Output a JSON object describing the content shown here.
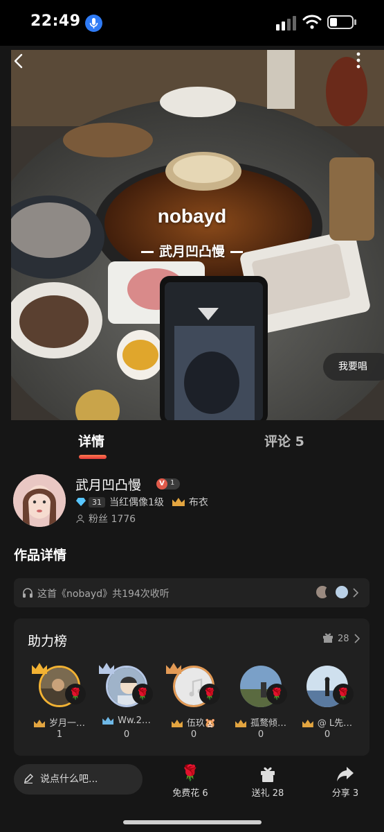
{
  "status_bar": {
    "time": "22:49"
  },
  "song": {
    "title": "nobayd",
    "artist": "武月凹凸慢",
    "sing_button": "我要唱"
  },
  "tabs": [
    {
      "label": "详情"
    },
    {
      "label": "评论 5"
    }
  ],
  "user": {
    "name": "武月凹凸慢",
    "vip_letter": "V",
    "vip_level": "1",
    "diamond_count": "31",
    "idol_level": "当红偶像1级",
    "title": "布衣",
    "fans": "粉丝 1776"
  },
  "section_title": "作品详情",
  "listen_info": "这首《nobayd》共194次收听",
  "board": {
    "title": "助力榜",
    "gift_count": "28",
    "ranks": [
      {
        "rank": "1",
        "name": "岁月一…",
        "score": "1",
        "crown_color": "#f2b233"
      },
      {
        "rank": "2",
        "name": "Ww.2…",
        "score": "0",
        "crown_color": "#b6c8e6"
      },
      {
        "rank": "3",
        "name": "伍玖🐹",
        "score": "0",
        "crown_color": "#e39a55"
      },
      {
        "rank": "",
        "name": "孤鹜倾…",
        "score": "0",
        "crown_color": ""
      },
      {
        "rank": "",
        "name": "@ L先…",
        "score": "0",
        "crown_color": ""
      }
    ]
  },
  "bottom": {
    "comment_placeholder": "说点什么吧...",
    "free_flowers": "免费花 6",
    "send_gift": "送礼 28",
    "share": "分享 3"
  }
}
